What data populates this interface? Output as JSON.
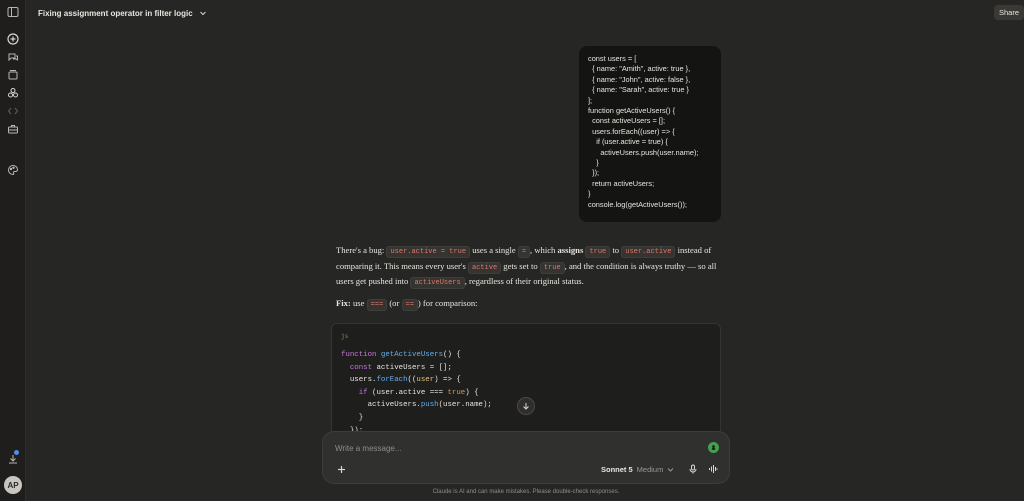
{
  "header": {
    "title": "Fixing assignment operator in filter logic",
    "share_label": "Share"
  },
  "sidebar": {
    "items": [
      {
        "name": "sidebar-toggle-icon"
      },
      {
        "name": "new-chat-icon"
      },
      {
        "name": "chats-icon"
      },
      {
        "name": "projects-icon"
      },
      {
        "name": "artifacts-icon"
      },
      {
        "name": "code-icon"
      },
      {
        "name": "briefcase-icon"
      },
      {
        "name": "palette-icon"
      }
    ],
    "avatar_initials": "AP"
  },
  "user_message": {
    "code": "const users = [\n  { name: \"Amith\", active: true },\n  { name: \"John\", active: false },\n  { name: \"Sarah\", active: true }\n];\nfunction getActiveUsers() {\n  const activeUsers = [];\n  users.forEach((user) => {\n    if (user.active = true) {\n      activeUsers.push(user.name);\n    }\n  });\n  return activeUsers;\n}\nconsole.log(getActiveUsers());"
  },
  "assistant": {
    "p1": {
      "t1": "There's a bug: ",
      "c1": "user.active = true",
      "t2": " uses a single ",
      "c2": "=",
      "t3": ", which ",
      "b1": "assigns",
      "t4": " ",
      "c3": "true",
      "t5": " to ",
      "c4": "user.active",
      "t6": " instead of comparing it. This means every user's ",
      "c5": "active",
      "t7": " gets set to ",
      "c6": "true",
      "t8": ", and the condition is always truthy — so all users get pushed into ",
      "c7": "activeUsers",
      "t9": ", regardless of their original status."
    },
    "p2": {
      "b1": "Fix:",
      "t1": " use ",
      "c1": "===",
      "t2": " (or ",
      "c2": "==",
      "t3": ") for comparison:"
    },
    "code_block": {
      "lang": "js",
      "lines": {
        "l1": {
          "kw": "function",
          "fn": "getActiveUsers",
          "rest": "() {"
        },
        "l2": {
          "indent": "  ",
          "kw": "const",
          "rest": " activeUsers = [];"
        },
        "l3": {
          "indent": "  ",
          "a": "users.",
          "fn": "forEach",
          "b": "((",
          "pr": "user",
          "c": ") => {"
        },
        "l4": {
          "indent": "    ",
          "kw": "if",
          "a": " (user.active === ",
          "nm": "true",
          "b": ") {"
        },
        "l5": {
          "indent": "      ",
          "a": "activeUsers.",
          "fn": "push",
          "b": "(user.name);"
        },
        "l6": {
          "text": "    }"
        },
        "l7": {
          "text": "  });"
        }
      }
    }
  },
  "composer": {
    "placeholder": "Write a message...",
    "model_name": "Sonnet 5",
    "model_mode": "Medium"
  },
  "disclaimer": "Claude is AI and can make mistakes. Please double-check responses.",
  "colors": {
    "background": "#262624",
    "sidebar": "#1f1e1d",
    "accent_green": "#3fa34d",
    "inline_code": "#e0766a"
  }
}
